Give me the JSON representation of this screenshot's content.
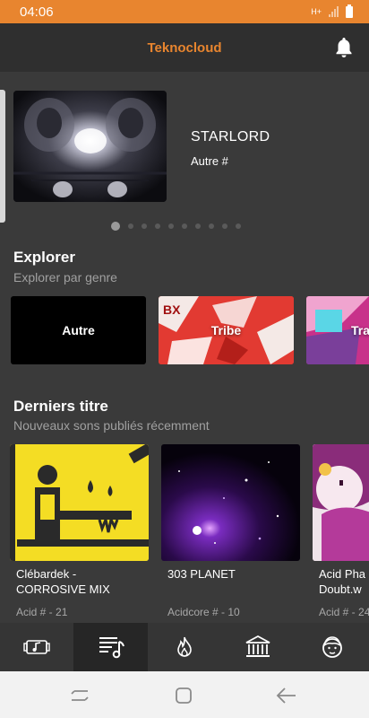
{
  "status": {
    "time": "04:06",
    "network": "H+"
  },
  "app": {
    "title": "Teknocloud"
  },
  "featured": {
    "title": "STARLORD",
    "subtitle": "Autre #",
    "dots_total": 10,
    "active_dot": 0
  },
  "explore": {
    "title": "Explorer",
    "subtitle": "Explorer par genre",
    "genres": [
      {
        "label": "Autre"
      },
      {
        "label": "Tribe"
      },
      {
        "label": "Tra"
      }
    ]
  },
  "latest": {
    "title": "Derniers titre",
    "subtitle": "Nouveaux sons publiés récemment",
    "tracks": [
      {
        "title": "Clébardek -\nCORROSIVE MIX",
        "meta": "Acid # - 21"
      },
      {
        "title": "303 PLANET",
        "meta": "Acidcore # - 10"
      },
      {
        "title": "Acid Pha\nDoubt.w",
        "meta": "Acid # - 24"
      }
    ]
  },
  "tabs": [
    {
      "icon": "music-gallery-icon",
      "active": false
    },
    {
      "icon": "playlist-icon",
      "active": true
    },
    {
      "icon": "flame-icon",
      "active": false
    },
    {
      "icon": "library-icon",
      "active": false
    },
    {
      "icon": "profile-face-icon",
      "active": false
    }
  ],
  "colors": {
    "accent": "#e8852f",
    "background": "#3a3a3a"
  }
}
